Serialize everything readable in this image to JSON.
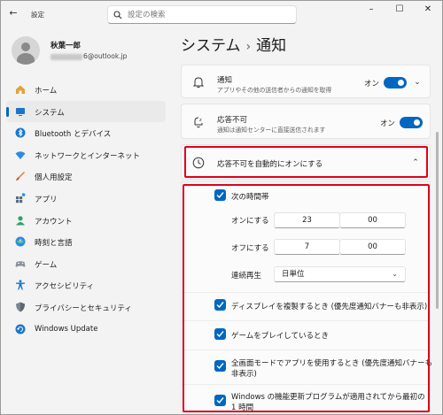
{
  "app": {
    "title": "設定"
  },
  "search": {
    "placeholder": "設定の検索"
  },
  "user": {
    "name": "秋葉一郎",
    "email_visible": "6@outlook.jp"
  },
  "nav": [
    {
      "label": "ホーム",
      "icon": "home-icon"
    },
    {
      "label": "システム",
      "icon": "system-icon",
      "active": true
    },
    {
      "label": "Bluetooth とデバイス",
      "icon": "bluetooth-icon"
    },
    {
      "label": "ネットワークとインターネット",
      "icon": "wifi-icon"
    },
    {
      "label": "個人用設定",
      "icon": "brush-icon"
    },
    {
      "label": "アプリ",
      "icon": "apps-icon"
    },
    {
      "label": "アカウント",
      "icon": "account-icon"
    },
    {
      "label": "時刻と言語",
      "icon": "clock-icon"
    },
    {
      "label": "ゲーム",
      "icon": "gamepad-icon"
    },
    {
      "label": "アクセシビリティ",
      "icon": "accessibility-icon"
    },
    {
      "label": "プライバシーとセキュリティ",
      "icon": "shield-icon"
    },
    {
      "label": "Windows Update",
      "icon": "update-icon"
    }
  ],
  "breadcrumb": {
    "parent": "システム",
    "separator": "›",
    "current": "通知"
  },
  "notifications": {
    "title": "通知",
    "subtitle": "アプリやその他の送信者からの通知を取得",
    "state": "オン"
  },
  "dnd": {
    "title": "応答不可",
    "subtitle": "通知は通知センターに直接送信されます",
    "state": "オン"
  },
  "auto_dnd": {
    "title": "応答不可を自動的にオンにする",
    "schedule_label": "次の時間帯",
    "on_label": "オンにする",
    "on_hour": "23",
    "on_minute": "00",
    "off_label": "オフにする",
    "off_hour": "7",
    "off_minute": "00",
    "repeat_label": "連続再生",
    "repeat_value": "日単位",
    "options": [
      "ディスプレイを複製するとき (優先度通知バナーも非表示)",
      "ゲームをプレイしているとき",
      "全画面モードでアプリを使用するとき (優先度通知バナーも",
      "非表示)",
      "Windows の機能更新プログラムが適用されてから最初の",
      "1 時間"
    ]
  },
  "colors": {
    "accent": "#0067c0",
    "highlight": "#e0001b"
  }
}
